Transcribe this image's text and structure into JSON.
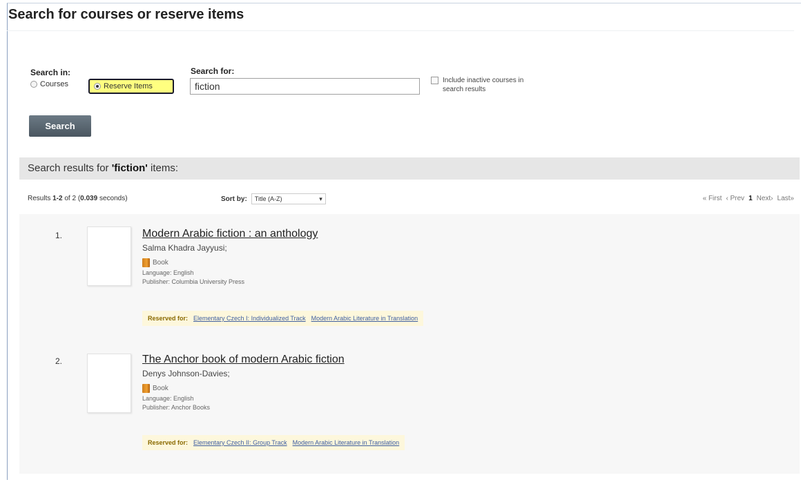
{
  "page": {
    "title": "Search for courses or reserve items"
  },
  "search": {
    "search_in_label": "Search in:",
    "option_courses": "Courses",
    "option_reserve": "Reserve Items",
    "search_for_label": "Search for:",
    "query": "fiction",
    "inactive_label_1": "Include inactive courses in",
    "inactive_label_2": "search results",
    "button": "Search"
  },
  "results": {
    "header_prefix": "Search results for ",
    "header_query": "'fiction'",
    "header_suffix": " items:",
    "count_prefix": "Results ",
    "count_range": "1-2",
    "count_of": " of 2 (",
    "count_time": "0.039",
    "count_suffix": " seconds)",
    "sort_label": "Sort by:",
    "sort_value": "Title (A-Z)",
    "sort_arrow": "▾",
    "pager": {
      "first": "« First",
      "prev": "‹ Prev",
      "current": "1",
      "next": "Next›",
      "last": "Last»"
    },
    "items": [
      {
        "num": "1.",
        "title": "Modern Arabic fiction : an anthology",
        "author": "Salma Khadra Jayyusi;",
        "format": "Book",
        "language": "Language: English",
        "publisher": "Publisher: Columbia University Press",
        "reserved_label": "Reserved for:",
        "courses": [
          "Elementary Czech I: Individualized Track",
          "Modern Arabic Literature in Translation"
        ]
      },
      {
        "num": "2.",
        "title": "The Anchor book of modern Arabic fiction",
        "author": "Denys Johnson-Davies;",
        "format": "Book",
        "language": "Language: English",
        "publisher": "Publisher: Anchor Books",
        "reserved_label": "Reserved for:",
        "courses": [
          "Elementary Czech II: Group Track",
          "Modern Arabic Literature in Translation"
        ]
      }
    ]
  }
}
